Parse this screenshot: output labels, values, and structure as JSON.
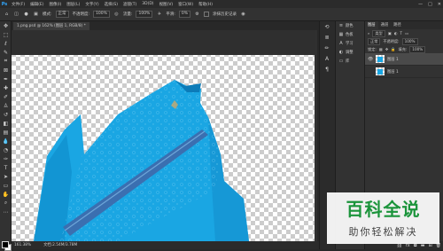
{
  "menubar": {
    "items": [
      "文件(F)",
      "编辑(E)",
      "图像(I)",
      "图层(L)",
      "文字(Y)",
      "选择(S)",
      "滤镜(T)",
      "3D(D)",
      "视图(V)",
      "窗口(W)",
      "帮助(H)"
    ],
    "window_controls": [
      "—",
      "□",
      "✕"
    ]
  },
  "options": {
    "mode_label": "模式:",
    "mode_value": "正常",
    "opacity_label": "不透明度:",
    "opacity_value": "100%",
    "flow_label": "流量:",
    "flow_value": "100%",
    "smooth_label": "平滑:",
    "smooth_value": "0%",
    "history_label": "涂抹历史记录"
  },
  "document": {
    "tab_title": "1.png.psd @ 162% (图层 1, RGB/8) *",
    "zoom": "161.38%",
    "doc_info": "文档:2.54M/3.78M"
  },
  "mini_panel": {
    "items": [
      {
        "icon": "≡",
        "label": "颜色"
      },
      {
        "icon": "▦",
        "label": "色板"
      },
      {
        "icon": "A",
        "label": "学习"
      },
      {
        "icon": "◐",
        "label": "调整"
      },
      {
        "icon": "▭",
        "label": "库"
      }
    ]
  },
  "layers_panel": {
    "tabs": [
      "图层",
      "通道",
      "路径"
    ],
    "kind_label": "类型",
    "blend_mode": "正常",
    "opacity_label": "不透明度:",
    "opacity_value": "100%",
    "lock_label": "锁定:",
    "fill_label": "填充:",
    "fill_value": "100%",
    "layers": [
      {
        "name": "图层 1",
        "selected": true
      },
      {
        "name": "图层 1",
        "selected": false
      }
    ]
  },
  "watermark": {
    "title": "百科全说",
    "subtitle": "助你轻松解决"
  },
  "colors": {
    "garment": "#1aa6e3",
    "garment_dark": "#0f7fb6",
    "watermark_green": "#1a9c3c"
  }
}
